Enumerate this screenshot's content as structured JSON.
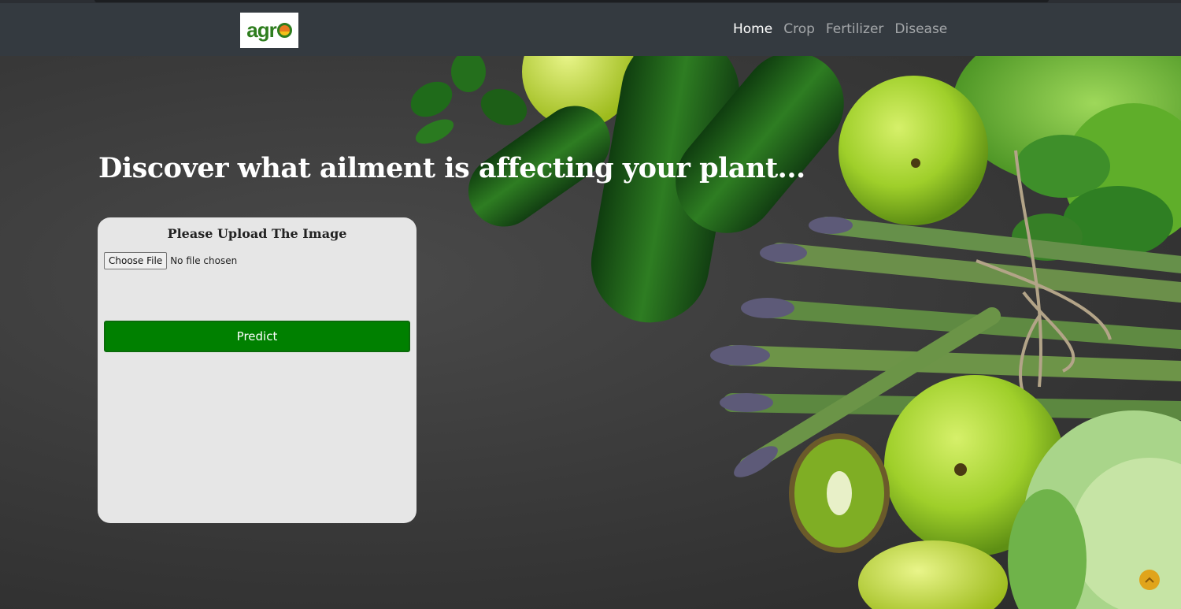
{
  "brand": {
    "logo_text": "agr"
  },
  "nav": {
    "items": [
      {
        "label": "Home",
        "active": true
      },
      {
        "label": "Crop",
        "active": false
      },
      {
        "label": "Fertilizer",
        "active": false
      },
      {
        "label": "Disease",
        "active": false
      }
    ]
  },
  "hero": {
    "headline": "Discover what ailment is affecting your plant..."
  },
  "upload_card": {
    "title": "Please Upload The Image",
    "file_button_label": "Choose File",
    "file_status": "No file chosen",
    "predict_label": "Predict"
  },
  "colors": {
    "navbar": "#343a40",
    "predict_button": "#008000",
    "card_background": "#e6e6e6",
    "scroll_top_button": "#e0a41b"
  },
  "icons": {
    "logo": "agro-logo",
    "scroll_top": "chevron-up-icon"
  }
}
